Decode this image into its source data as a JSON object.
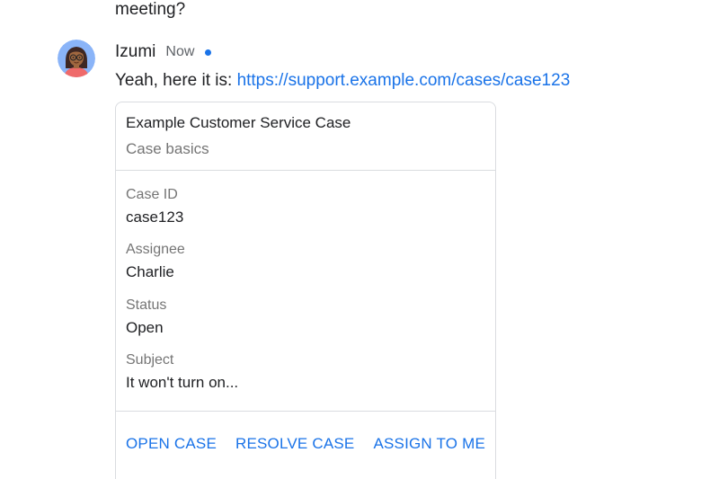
{
  "previous_message": {
    "text": "meeting?"
  },
  "message": {
    "sender": "Izumi",
    "timestamp": "Now",
    "text_prefix": "Yeah, here it is: ",
    "link": "https://support.example.com/cases/case123"
  },
  "card": {
    "title": "Example Customer Service Case",
    "subtitle": "Case basics",
    "fields": [
      {
        "label": "Case ID",
        "value": "case123"
      },
      {
        "label": "Assignee",
        "value": "Charlie"
      },
      {
        "label": "Status",
        "value": "Open"
      },
      {
        "label": "Subject",
        "value": "It won't turn on..."
      }
    ],
    "actions": [
      "OPEN CASE",
      "RESOLVE CASE",
      "ASSIGN TO ME"
    ]
  },
  "colors": {
    "link": "#1a73e8",
    "unread_dot": "#1a73e8",
    "border": "#dadce0",
    "secondary_text": "#757575"
  }
}
